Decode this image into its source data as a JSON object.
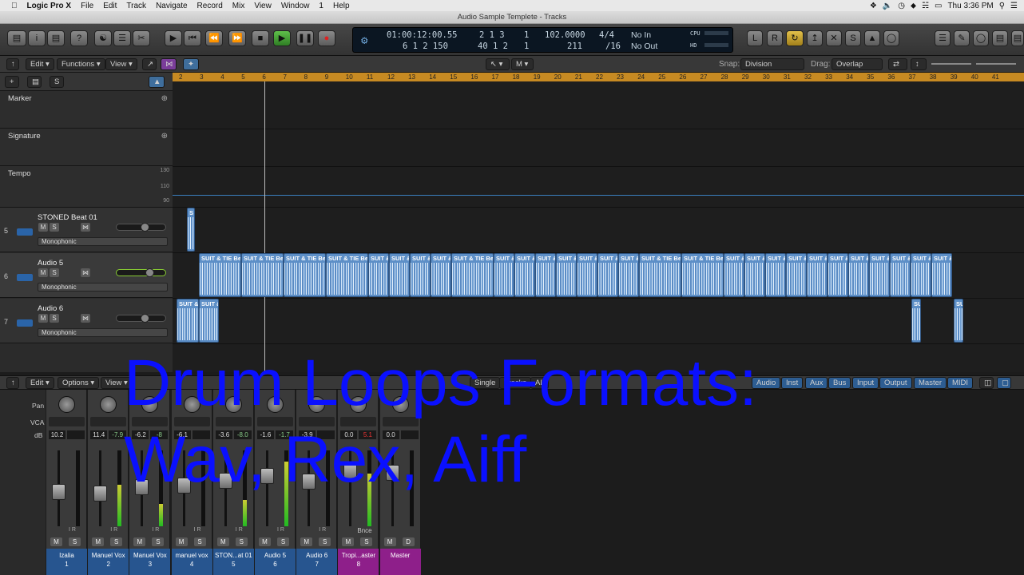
{
  "menubar": {
    "apple": "",
    "app": "Logic Pro X",
    "items": [
      "File",
      "Edit",
      "Track",
      "Navigate",
      "Record",
      "Mix",
      "View",
      "Window",
      "1",
      "Help"
    ],
    "clock": "Thu 3:36 PM"
  },
  "window": {
    "title": "Audio Sample Templete - Tracks"
  },
  "lcd": {
    "time": "01:00:12:00.55",
    "bars": "2  1  3",
    "beat_div": "1",
    "tempo": "102.0000",
    "sig": "4/4",
    "in": "No In",
    "pos2": "6  1  2  150",
    "pos3": "40  1  2",
    "div2": "1",
    "v211": "211",
    "div": "/16",
    "out": "No Out",
    "cpu": "CPU",
    "hd": "HD"
  },
  "tracks_toolbar": {
    "edit": "Edit",
    "functions": "Functions",
    "view": "View",
    "snap_label": "Snap:",
    "snap_value": "Division",
    "drag_label": "Drag:",
    "drag_value": "Overlap"
  },
  "ruler": [
    "2",
    "3",
    "4",
    "5",
    "6",
    "7",
    "8",
    "9",
    "10",
    "11",
    "12",
    "13",
    "14",
    "15",
    "16",
    "17",
    "18",
    "19",
    "20",
    "21",
    "22",
    "23",
    "24",
    "25",
    "26",
    "27",
    "28",
    "29",
    "30",
    "31",
    "32",
    "33",
    "34",
    "35",
    "36",
    "37",
    "38",
    "39",
    "40",
    "41"
  ],
  "global_tracks": [
    {
      "label": "Marker"
    },
    {
      "label": "Signature"
    },
    {
      "label": "Tempo",
      "t1": "130",
      "t2": "110",
      "t3": "90"
    }
  ],
  "tracks": [
    {
      "num": "5",
      "name": "STONED Beat 01",
      "mode": "Monophonic"
    },
    {
      "num": "6",
      "name": "Audio 5",
      "mode": "Monophonic"
    },
    {
      "num": "7",
      "name": "Audio 6",
      "mode": "Monophonic"
    }
  ],
  "region_labels": {
    "a": "SUIT & TIE Be",
    "b": "SUIT &",
    "c": "S",
    "d": "SU"
  },
  "mixer": {
    "edit": "Edit",
    "options": "Options",
    "view": "View",
    "single": "Single",
    "tracks": "Tracks",
    "all": "All",
    "filters": [
      "Audio",
      "Inst",
      "Aux",
      "Bus",
      "Input",
      "Output",
      "Master",
      "MIDI"
    ],
    "labels": {
      "pan": "Pan",
      "vca": "VCA",
      "db": "dB"
    },
    "strips": [
      {
        "name": "Izalia",
        "num": "1",
        "db": "10.2",
        "peak": ""
      },
      {
        "name": "Manuel Vox",
        "num": "2",
        "db": "11.4",
        "peak": "-7.9"
      },
      {
        "name": "Manuel Vox",
        "num": "3",
        "db": "-6.2",
        "peak": "-8"
      },
      {
        "name": "manuel vox",
        "num": "4",
        "db": "-6.1",
        "peak": ""
      },
      {
        "name": "STON...at 01",
        "num": "5",
        "db": "-3.6",
        "peak": "-8.0"
      },
      {
        "name": "Audio 5",
        "num": "6",
        "db": "-1.6",
        "peak": "-1.7"
      },
      {
        "name": "Audio 6",
        "num": "7",
        "db": "-3.9",
        "peak": ""
      },
      {
        "name": "Tropi...aster",
        "num": "8",
        "db": "0.0",
        "peak": "5.1"
      },
      {
        "name": "Master",
        "num": "",
        "db": "0.0",
        "peak": ""
      }
    ],
    "bnce": "Bnce",
    "m": "M",
    "s": "S",
    "d": "D",
    "i": "I",
    "r": "R"
  },
  "overlay": {
    "line1": "Drum Loops Formats:",
    "line2": "Wav, Rex, Aiff"
  }
}
